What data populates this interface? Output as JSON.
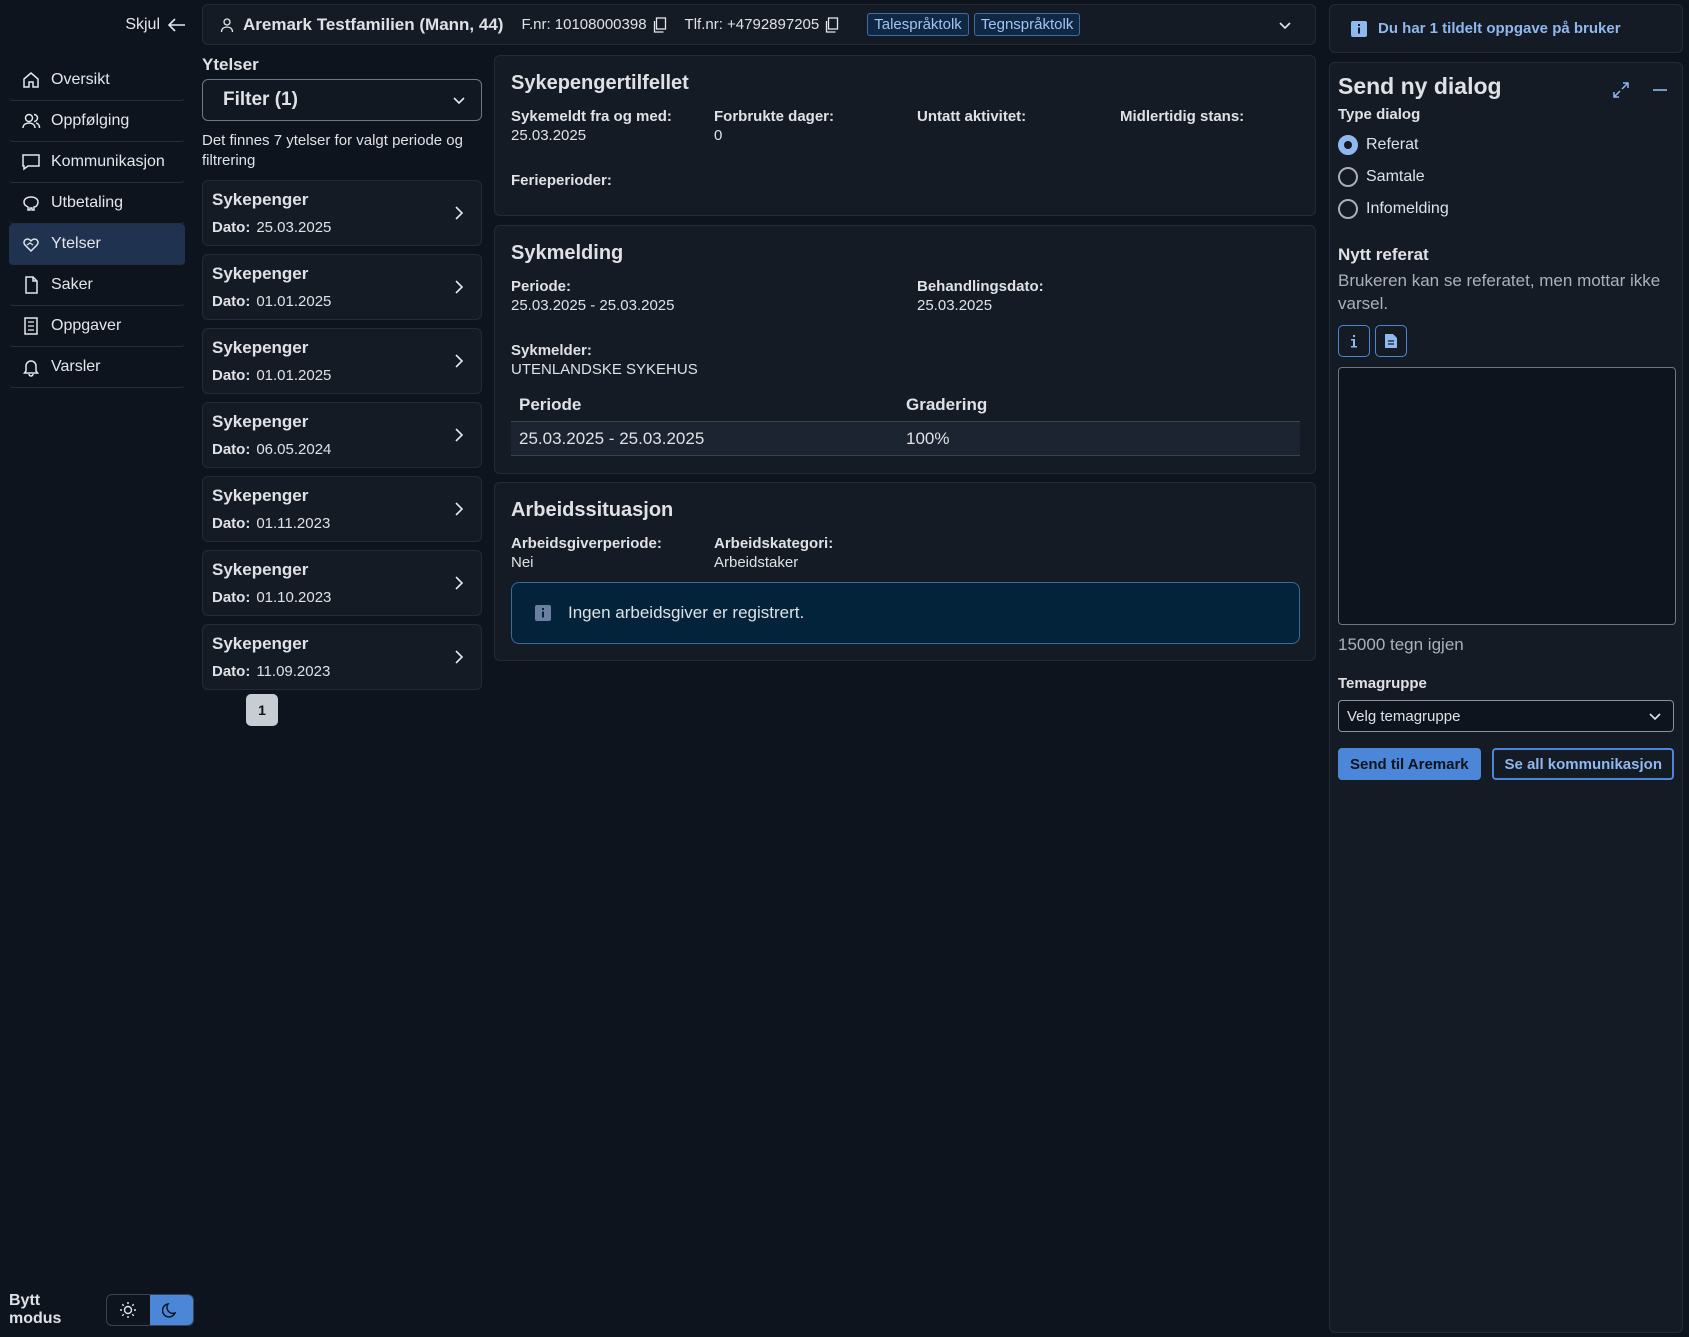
{
  "sidebar": {
    "hide_label": "Skjul",
    "items": [
      {
        "label": "Oversikt",
        "icon": "house-icon"
      },
      {
        "label": "Oppfølging",
        "icon": "people-icon"
      },
      {
        "label": "Kommunikasjon",
        "icon": "chat-icon"
      },
      {
        "label": "Utbetaling",
        "icon": "piggybank-icon"
      },
      {
        "label": "Ytelser",
        "icon": "heart-hand-icon",
        "active": true
      },
      {
        "label": "Saker",
        "icon": "file-icon"
      },
      {
        "label": "Oppgaver",
        "icon": "tasklist-icon"
      },
      {
        "label": "Varsler",
        "icon": "bell-icon"
      }
    ],
    "mode_label": "Bytt modus"
  },
  "header": {
    "user_name": "Aremark Testfamilien (Mann, 44)",
    "fnr": "F.nr: 10108000398",
    "tlf": "Tlf.nr: +4792897205",
    "tags": [
      "Talespråktolk",
      "Tegnspråktolk"
    ]
  },
  "ytelser": {
    "title": "Ytelser",
    "filter_label": "Filter (1)",
    "info": "Det finnes 7 ytelser for valgt periode og filtrering",
    "items": [
      {
        "title": "Sykepenger",
        "date_label": "Dato:",
        "date": "25.03.2025"
      },
      {
        "title": "Sykepenger",
        "date_label": "Dato:",
        "date": "01.01.2025"
      },
      {
        "title": "Sykepenger",
        "date_label": "Dato:",
        "date": "01.01.2025"
      },
      {
        "title": "Sykepenger",
        "date_label": "Dato:",
        "date": "06.05.2024"
      },
      {
        "title": "Sykepenger",
        "date_label": "Dato:",
        "date": "01.11.2023"
      },
      {
        "title": "Sykepenger",
        "date_label": "Dato:",
        "date": "01.10.2023"
      },
      {
        "title": "Sykepenger",
        "date_label": "Dato:",
        "date": "11.09.2023"
      }
    ],
    "page": "1"
  },
  "tilfelle": {
    "title": "Sykepengertilfellet",
    "sykemeldt_label": "Sykemeldt fra og med:",
    "sykemeldt_value": "25.03.2025",
    "forbrukte_label": "Forbrukte dager:",
    "forbrukte_value": "0",
    "untatt_label": "Untatt aktivitet:",
    "midlertidig_label": "Midlertidig stans:",
    "ferie_label": "Ferieperioder:"
  },
  "sykmelding": {
    "title": "Sykmelding",
    "periode_label": "Periode:",
    "periode_value": "25.03.2025 - 25.03.2025",
    "behandling_label": "Behandlingsdato:",
    "behandling_value": "25.03.2025",
    "sykmelder_label": "Sykmelder:",
    "sykmelder_value": "UTENLANDSKE SYKEHUS",
    "table": {
      "headers": [
        "Periode",
        "Gradering"
      ],
      "rows": [
        [
          "25.03.2025 - 25.03.2025",
          "100%"
        ]
      ]
    }
  },
  "arbeid": {
    "title": "Arbeidssituasjon",
    "periode_label": "Arbeidsgiverperiode:",
    "periode_value": "Nei",
    "kategori_label": "Arbeidskategori:",
    "kategori_value": "Arbeidstaker",
    "info": "Ingen arbeidsgiver er registrert."
  },
  "task_banner": "Du har 1 tildelt oppgave på bruker",
  "dialog": {
    "title": "Send ny dialog",
    "type_label": "Type dialog",
    "options": [
      "Referat",
      "Samtale",
      "Infomelding"
    ],
    "selected": "Referat",
    "referat_title": "Nytt referat",
    "referat_desc": "Brukeren kan se referatet, men mottar ikke varsel.",
    "message_value": "",
    "char_count": "15000 tegn igjen",
    "tema_label": "Temagruppe",
    "tema_value": "Velg temagruppe",
    "send_label": "Send til Aremark",
    "all_label": "Se all kommunikasjon"
  },
  "colors": {
    "background": "#0e141e",
    "panel": "#151b25",
    "accent": "#4b86d8",
    "active_nav": "#1f3350",
    "info_box": "#02233a"
  }
}
